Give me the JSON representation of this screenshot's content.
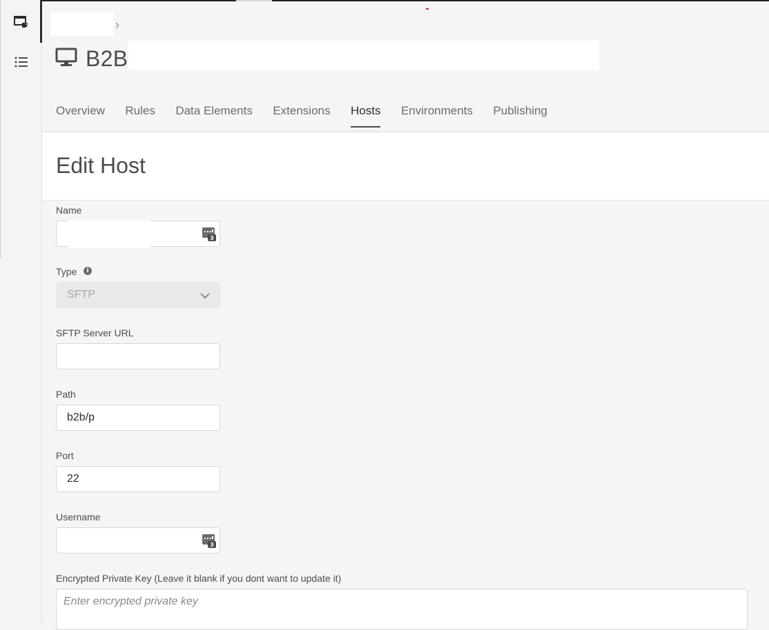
{
  "rail": {
    "items": [
      {
        "name": "properties-icon"
      },
      {
        "name": "list-icon"
      }
    ]
  },
  "breadcrumb": {
    "separator": "›"
  },
  "property": {
    "title_prefix": "B2B"
  },
  "tabs": [
    {
      "label": "Overview",
      "active": false
    },
    {
      "label": "Rules",
      "active": false
    },
    {
      "label": "Data Elements",
      "active": false
    },
    {
      "label": "Extensions",
      "active": false
    },
    {
      "label": "Hosts",
      "active": true
    },
    {
      "label": "Environments",
      "active": false
    },
    {
      "label": "Publishing",
      "active": false
    }
  ],
  "page": {
    "title": "Edit Host"
  },
  "form": {
    "name": {
      "label": "Name",
      "value": ""
    },
    "type": {
      "label": "Type",
      "value": "SFTP",
      "info_icon": "i"
    },
    "server_url": {
      "label": "SFTP Server URL",
      "value": ""
    },
    "path": {
      "label": "Path",
      "value": "b2b/p"
    },
    "port": {
      "label": "Port",
      "value": "22"
    },
    "username": {
      "label": "Username",
      "value": ""
    },
    "private_key": {
      "label": "Encrypted Private Key (Leave it blank if you dont want to update it)",
      "placeholder": "Enter encrypted private key"
    }
  },
  "colors": {
    "text": "#4b4b4b",
    "active_tab_underline": "#4b4b4b",
    "disabled_bg": "#e9e9e9"
  }
}
